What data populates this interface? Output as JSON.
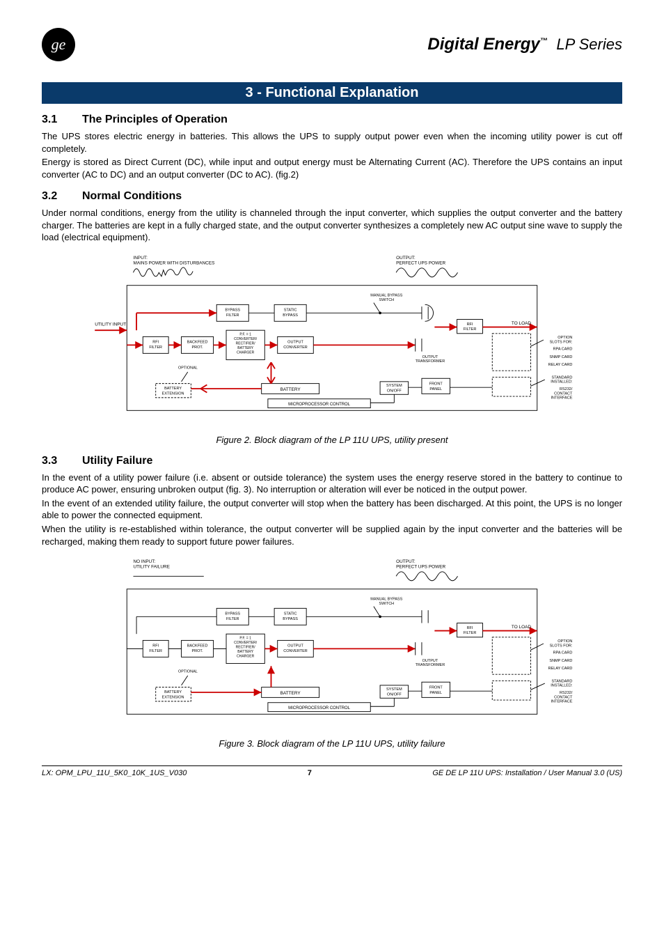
{
  "header": {
    "brand": "Digital Energy",
    "tm": "™",
    "series": "LP Series"
  },
  "chapter": {
    "title": "3  -  Functional Explanation"
  },
  "s31": {
    "num": "3.1",
    "title": "The Principles of Operation",
    "p1": "The  UPS  stores  electric  energy  in  batteries.  This  allows  the  UPS  to  supply  output  power  even  when  the incoming utility power is cut off completely.",
    "p2": "Energy  is  stored  as  Direct  Current  (DC),  while  input  and  output  energy  must  be  Alternating  Current  (AC). Therefore the UPS contains an input converter (AC to DC) and an output converter (DC to AC). (fig.2)"
  },
  "s32": {
    "num": "3.2",
    "title": "Normal Conditions",
    "p1": "Under normal conditions, energy from the utility is channeled through the input converter, which supplies the output  converter  and  the  battery  charger.  The  batteries  are  kept  in  a  fully  charged  state,  and  the  output converter synthesizes a completely new AC output sine wave to supply the load (electrical equipment)."
  },
  "fig2": {
    "input_label1": "INPUT:",
    "input_label2": "MAINS POWER WITH DISTURBANCES",
    "output_label1": "OUTPUT:",
    "output_label2": "PERFECT UPS POWER",
    "utility_input": "UTILITY INPUT",
    "bypass_filter": "BYPASS\nFILTER",
    "static_bypass": "STATIC\nBYPASS",
    "manual_bypass": "MANUAL BYPASS\nSWITCH",
    "rfi_filter": "RFI\nFILTER",
    "backfeed": "BACKFEED\nPROT.",
    "converter": "P.F. = 1\nCONVERTER/\nRECTIFIER/\nBATTERY\nCHARGER",
    "output_conv": "OUTPUT\nCONVERTER",
    "output_trans": "OUTPUT\nTRANSFORMER",
    "rfi_filter2": "RFI\nFILTER",
    "to_load": "TO LOAD",
    "optional": "OPTIONAL",
    "battery_ext": "BATTERY\nEXTENSION",
    "battery": "BATTERY",
    "micro": "MICROPROCESSOR CONTROL",
    "system_onoff": "SYSTEM\nON/OFF",
    "front_panel": "FRONT\nPANEL",
    "option_slots": "OPTION\nSLOTS FOR:",
    "rpa": "RPA CARD",
    "snmp": "SNMP CARD",
    "relay": "RELAY CARD",
    "standard": "STANDARD\nINSTALLED:",
    "rs232": "RS232/\nCONTACT\nINTERFACE",
    "caption": "Figure 2.  Block diagram of the LP 11U UPS, utility present"
  },
  "s33": {
    "num": "3.3",
    "title": "Utility Failure",
    "p1": "In  the  event  of  a  utility  power  failure  (i.e.  absent  or  outside  tolerance)  the  system  uses  the  energy  reserve stored  in  the  battery  to  continue  to  produce  AC  power,  ensuring  unbroken  output  (fig.  3).  No  interruption  or alteration will ever be noticed in the output power.",
    "p2": "In the event of an extended utility failure, the output converter will stop when the battery has been discharged. At this point, the UPS is no longer able to power the connected equipment.",
    "p3": "When  the  utility  is  re-established  within  tolerance,  the  output  converter  will  be  supplied  again  by  the  input converter and the batteries will be recharged, making them ready to support future power failures."
  },
  "fig3": {
    "input_label1": "NO INPUT:",
    "input_label2": "UTILITY FAILURE",
    "caption": "Figure 3.  Block diagram of the LP 11U UPS, utility failure"
  },
  "footer": {
    "left": "LX: OPM_LPU_11U_5K0_10K_1US_V030",
    "center": "7",
    "right": "GE DE LP 11U UPS: Installation / User Manual 3.0 (US)"
  }
}
